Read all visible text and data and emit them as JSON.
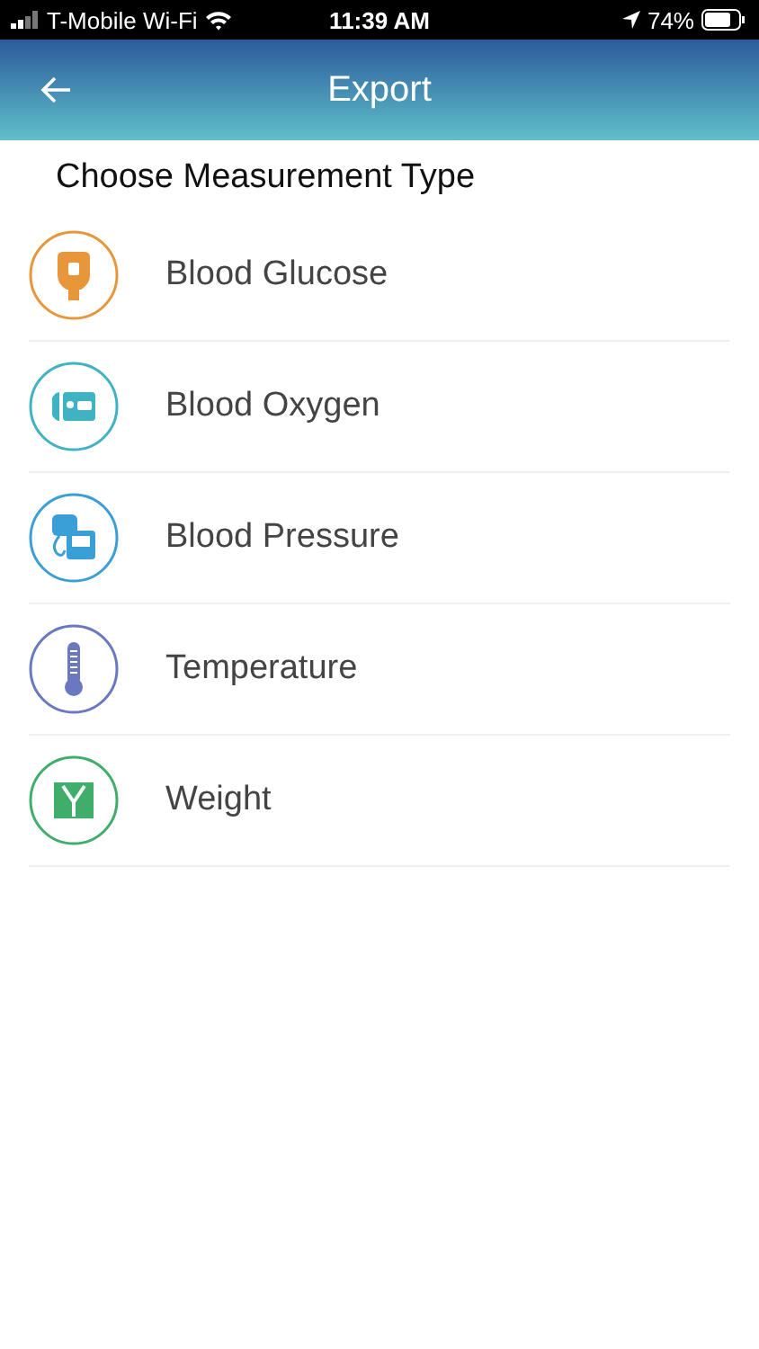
{
  "status_bar": {
    "carrier": "T-Mobile Wi-Fi",
    "time": "11:39 AM",
    "battery": "74%"
  },
  "header": {
    "title": "Export"
  },
  "section_title": "Choose Measurement Type",
  "items": [
    {
      "label": "Blood Glucose",
      "kind": "glucose",
      "color": "#e8963a"
    },
    {
      "label": "Blood Oxygen",
      "kind": "oxygen",
      "color": "#3fb3c4"
    },
    {
      "label": "Blood Pressure",
      "kind": "pressure",
      "color": "#3a9fd6"
    },
    {
      "label": "Temperature",
      "kind": "temperature",
      "color": "#6a78c2"
    },
    {
      "label": "Weight",
      "kind": "weight",
      "color": "#3fae6a"
    }
  ]
}
